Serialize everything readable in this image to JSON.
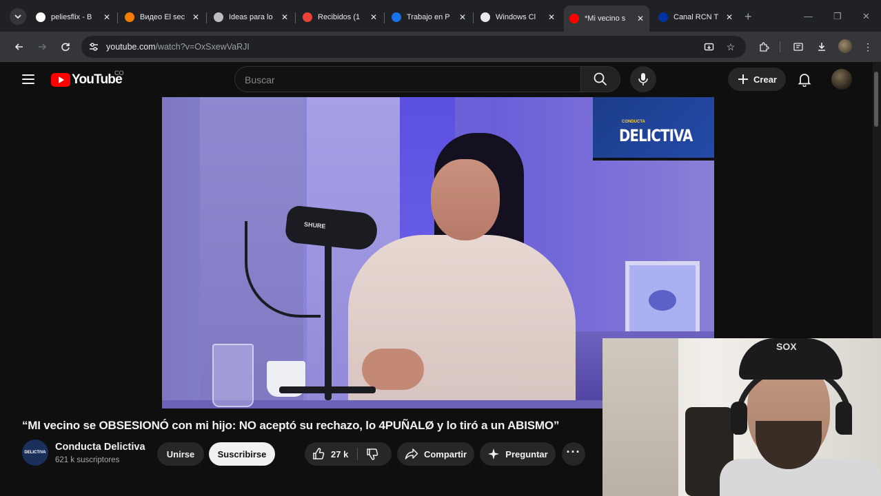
{
  "browser": {
    "tabs": [
      {
        "title": "peliesflix - B",
        "icon": "google-icon",
        "color": "#ffffff"
      },
      {
        "title": "Видео El sec",
        "icon": "blogger-icon",
        "color": "#f57c00"
      },
      {
        "title": "Ideas para lo",
        "icon": "openai-icon",
        "color": "#bdbdbd"
      },
      {
        "title": "Recibidos (1",
        "icon": "gmail-icon",
        "color": "#ea4335"
      },
      {
        "title": "Trabajo en P",
        "icon": "generic-site-icon",
        "color": "#1a73e8"
      },
      {
        "title": "Windows Cl",
        "icon": "github-icon",
        "color": "#e8eaed"
      },
      {
        "title": "*Mi vecino s",
        "icon": "youtube-icon",
        "color": "#ff0000",
        "active": true
      },
      {
        "title": "Canal RCN T",
        "icon": "rcn-icon",
        "color": "#0033a0"
      }
    ],
    "address": {
      "domain": "youtube.com",
      "path": "/watch?v=OxSxewVaRJI"
    }
  },
  "youtube": {
    "logo_text": "YouTube",
    "country_code": "CO",
    "search_placeholder": "Buscar",
    "create_label": "Crear"
  },
  "video": {
    "tv_small": "CONDUCTA",
    "tv_big": "DELICTIVA",
    "mic_brand": "SHURE",
    "title": "“MI vecino se OBSESIONÓ con mi hijo: NO aceptó su rechazo, lo 4PUÑALØ y lo tiró a un ABISMO”",
    "channel": {
      "name": "Conducta Delictiva",
      "subscribers": "621 k suscriptores",
      "avatar_text": "DELICTIVA"
    },
    "actions": {
      "join": "Unirse",
      "subscribe": "Suscribirse",
      "likes": "27 k",
      "share": "Compartir",
      "ask": "Preguntar"
    }
  },
  "webcam": {
    "cap_logo": "SOX"
  }
}
